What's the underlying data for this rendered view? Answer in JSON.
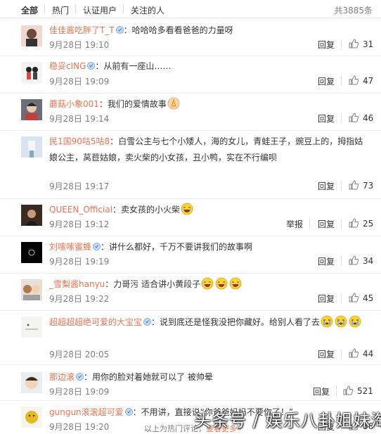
{
  "tabs": [
    {
      "label": "全部",
      "active": true
    },
    {
      "label": "热门",
      "active": false
    },
    {
      "label": "认证用户",
      "active": false
    },
    {
      "label": "关注的人",
      "active": false
    }
  ],
  "total_text": "共3885条",
  "actions": {
    "reply": "回复",
    "report": "举报"
  },
  "comments": [
    {
      "user": "佳佳酱吃胖了T_T",
      "text": "：哈哈哈多看看爸爸的力量呀",
      "time": "9月28日 19:10",
      "likes": "31"
    },
    {
      "user": "稳妥cING",
      "text": "：从前有一座山……",
      "time": "9月28日 19:09",
      "likes": "47"
    },
    {
      "user": "蘑菇小象001",
      "text": "：我们的爱情故事",
      "time": "9月28日 19:14",
      "likes": "46"
    },
    {
      "user": "民1国90咕5咕8",
      "text": "：白雪公主与七个小矮人，海的女儿，青蛙王子，豌豆上的，拇指姑娘公主，莴苣姑娘，卖火柴的小女孩，丑小鸭，实在不行编呗",
      "time": "9月28日 19:17",
      "likes": "73"
    },
    {
      "user": "QUEEN_Official",
      "text": "：卖女孩的小火柴",
      "time": "9月28日 19:12",
      "likes": "25"
    },
    {
      "user": "刘嗦嗦蜜蜂",
      "text": "：讲什么都好，千万不要讲我们的故事啊",
      "time": "9月28日 19:19",
      "likes": "34"
    },
    {
      "user": "_雪梨酱hanyu",
      "text": "：力哥污 适合讲小黄段子",
      "time": "9月28日 19:22",
      "likes": "45"
    },
    {
      "user": "超超超超绝可爱的大宝宝",
      "text": "：说到底还是怪我没把你藏好。给别人看了去",
      "time": "9月28日 20:05",
      "likes": "44"
    },
    {
      "user": "那边滚",
      "text": "：用你的脸对着她就可以了 被帅晕",
      "time": "9月28日 19:09",
      "likes": "521"
    },
    {
      "user": "gungun滚滚超可爱",
      "text": "：不用讲，直接说“你爸爸妈妈不要你了！”",
      "time": "9月28日 19:20",
      "likes": "86"
    }
  ],
  "footer": {
    "prefix": "以上为热门评论，",
    "more": "查看更多»"
  },
  "watermark": "头条号 / 娱乐八卦姐妹淘",
  "colors": {
    "username": "#eb7350",
    "meta": "#808080",
    "text": "#333333"
  }
}
